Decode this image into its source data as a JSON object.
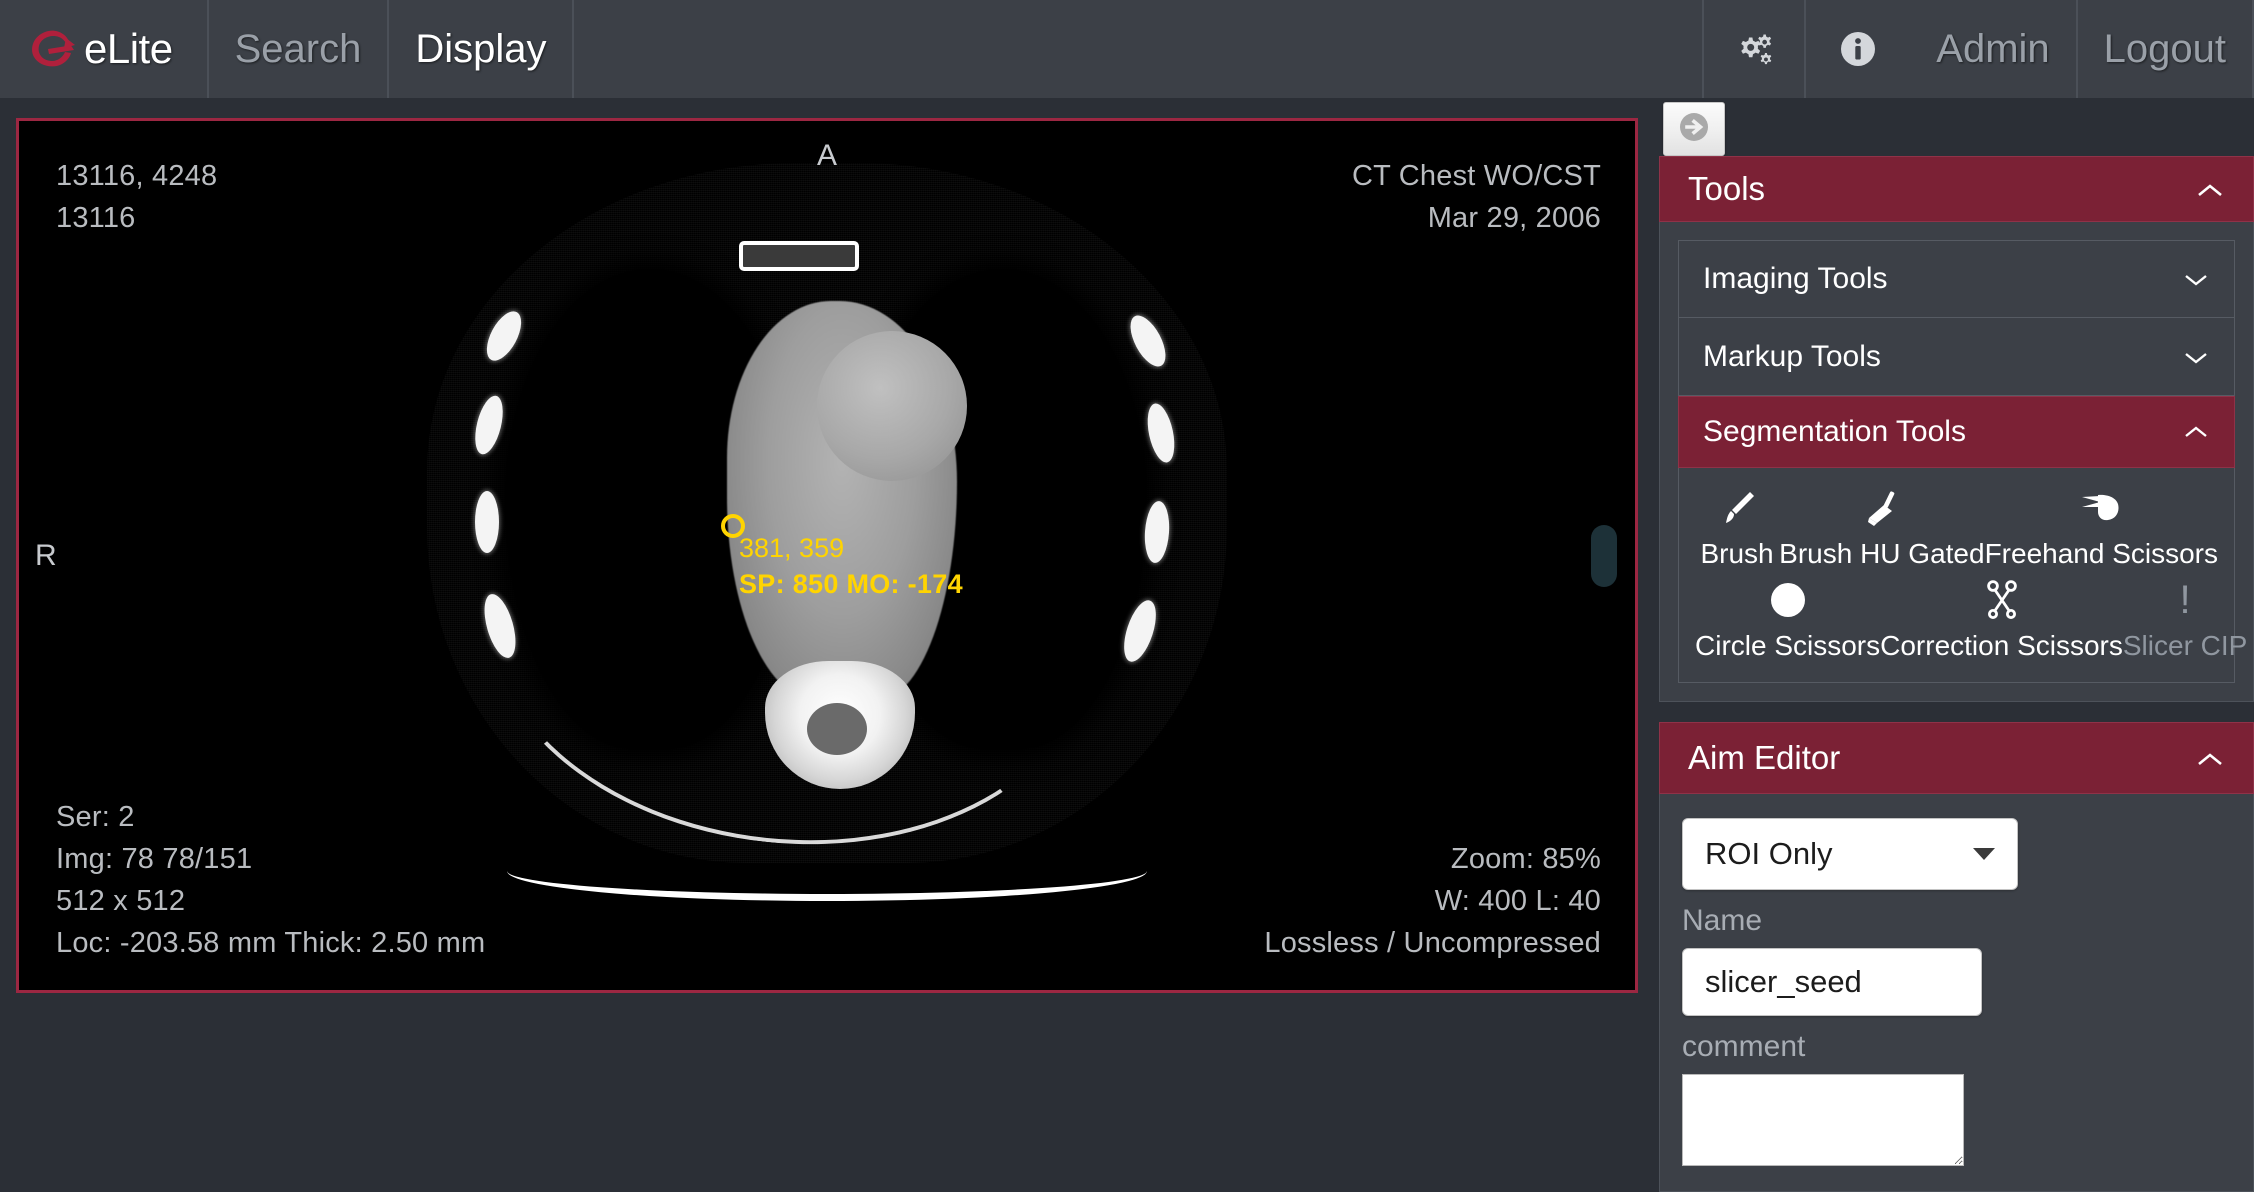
{
  "topbar": {
    "brand": "eLite",
    "brand_logo_icon": "elite-e-swirl-logo",
    "nav": [
      {
        "label": "Search",
        "active": false
      },
      {
        "label": "Display",
        "active": true
      }
    ],
    "settings_icon": "gears-icon",
    "info_icon": "info-circle-icon",
    "admin_label": "Admin",
    "logout_label": "Logout"
  },
  "viewport": {
    "orientation_top": "A",
    "orientation_left": "R",
    "overlay_top_left": "13116, 4248\n13116",
    "overlay_top_right": "CT Chest WO/CST\nMar 29, 2006",
    "overlay_bottom_left": "Ser: 2\nImg: 78 78/151\n512 x 512\nLoc: -203.58 mm Thick: 2.50 mm",
    "overlay_bottom_right": "Zoom: 85%\nW: 400 L: 40\nLossless / Uncompressed",
    "roi": {
      "coordinates": "381, 359",
      "stats": "SP: 850 MO: -174",
      "color": "#ffd400"
    },
    "border_color": "#9c2742",
    "scrollbar_name": "image-stack-scrollbar"
  },
  "right_panel": {
    "toggle_icon": "arrow-right-circle-icon",
    "tools": {
      "title": "Tools",
      "expanded": true,
      "chevron": "chevron-up-icon",
      "sections": [
        {
          "label": "Imaging Tools",
          "expanded": false,
          "chevron": "chevron-down-icon"
        },
        {
          "label": "Markup Tools",
          "expanded": false,
          "chevron": "chevron-down-icon"
        }
      ],
      "segmentation": {
        "label": "Segmentation Tools",
        "expanded": true,
        "chevron": "chevron-up-icon",
        "row1": [
          {
            "label": "Brush",
            "icon": "paint-brush-icon",
            "disabled": false
          },
          {
            "label": "Brush HU Gated",
            "icon": "broom-icon",
            "disabled": false
          },
          {
            "label": "Freehand Scissors",
            "icon": "hand-scissors-icon",
            "disabled": false
          }
        ],
        "row2": [
          {
            "label": "Circle Scissors",
            "icon": "filled-circle-icon",
            "disabled": false
          },
          {
            "label": "Correction Scissors",
            "icon": "scissors-icon",
            "disabled": false
          },
          {
            "label": "Slicer CIP",
            "icon": "exclamation-icon",
            "disabled": true
          }
        ]
      }
    },
    "aim_editor": {
      "title": "Aim Editor",
      "expanded": true,
      "chevron": "chevron-up-icon",
      "type_select_value": "ROI Only",
      "name_label": "Name",
      "name_value": "slicer_seed",
      "comment_label": "comment",
      "comment_value": ""
    }
  },
  "colors": {
    "accent_maroon": "#7b2135",
    "topbar_bg": "#3c4047",
    "page_bg": "#2b2f36",
    "panel_body_bg": "#3c4047",
    "annotation_yellow": "#ffd400",
    "viewport_border": "#9c2742"
  }
}
